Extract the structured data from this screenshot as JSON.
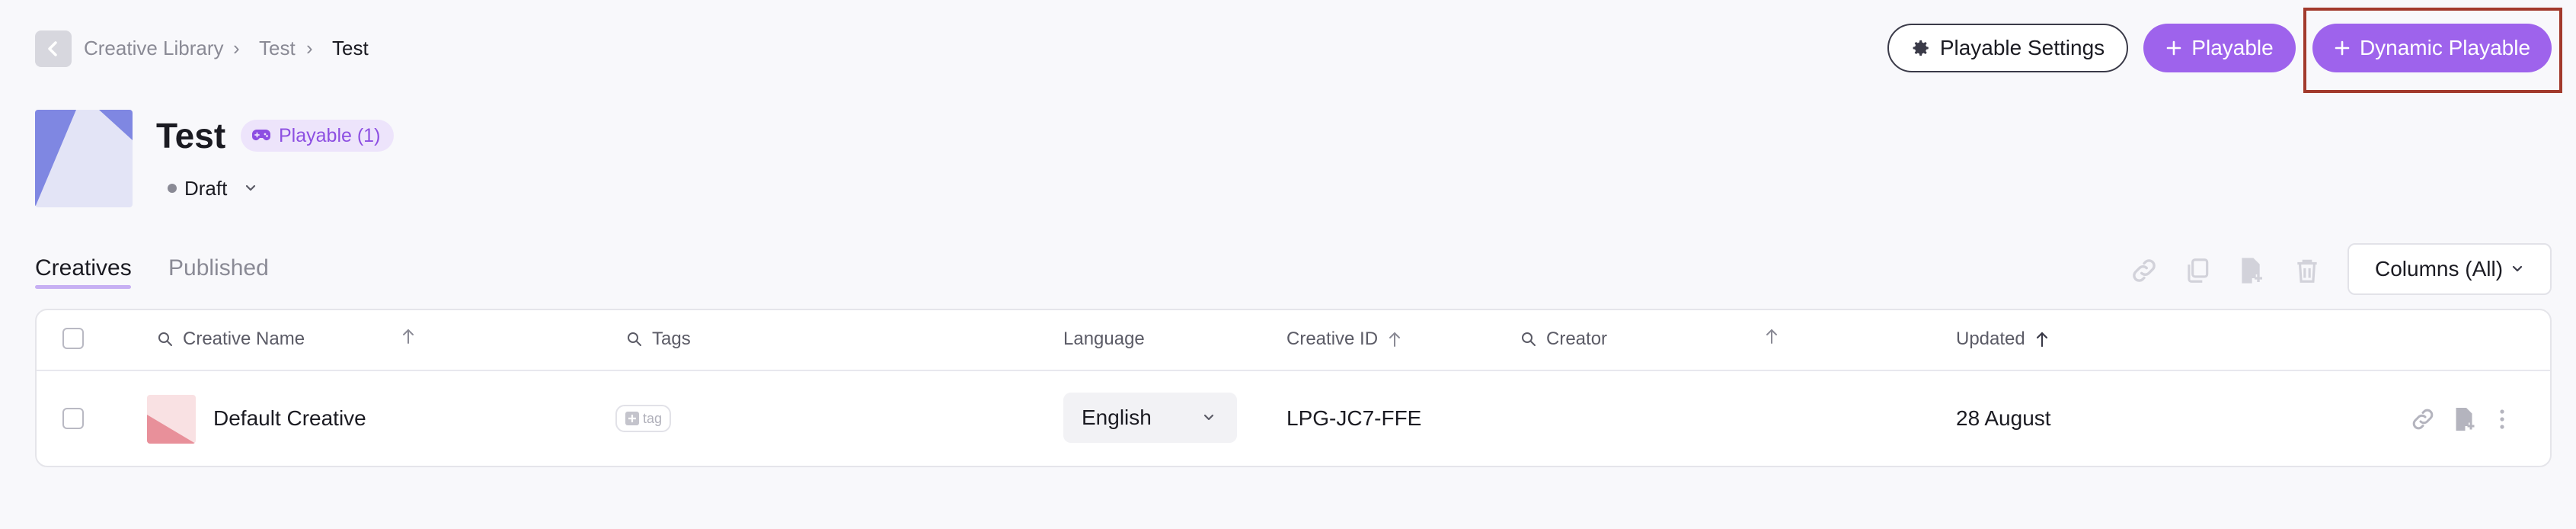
{
  "breadcrumb": {
    "items": [
      "Creative Library",
      "Test",
      "Test"
    ],
    "separator": "›"
  },
  "actions": {
    "settings_label": "Playable Settings",
    "playable_label": "Playable",
    "dynamic_playable_label": "Dynamic Playable"
  },
  "project": {
    "title": "Test",
    "type_badge": "Playable (1)",
    "status": "Draft"
  },
  "tabs": [
    {
      "label": "Creatives",
      "active": true
    },
    {
      "label": "Published",
      "active": false
    }
  ],
  "toolbar": {
    "icons": [
      "link-icon",
      "copy-icon",
      "file-add-icon",
      "trash-icon"
    ],
    "columns_label": "Columns (All)"
  },
  "table": {
    "columns": [
      "Creative Name",
      "Tags",
      "Language",
      "Creative ID",
      "Creator",
      "Updated"
    ],
    "rows": [
      {
        "name": "Default Creative",
        "tag_placeholder": "tag",
        "language": "English",
        "creative_id": "LPG-JC7-FFE",
        "creator": "",
        "updated": "28 August"
      }
    ]
  },
  "colors": {
    "accent": "#9e63ec",
    "highlight": "#a23a2c",
    "badge_bg": "#ede4fb"
  }
}
